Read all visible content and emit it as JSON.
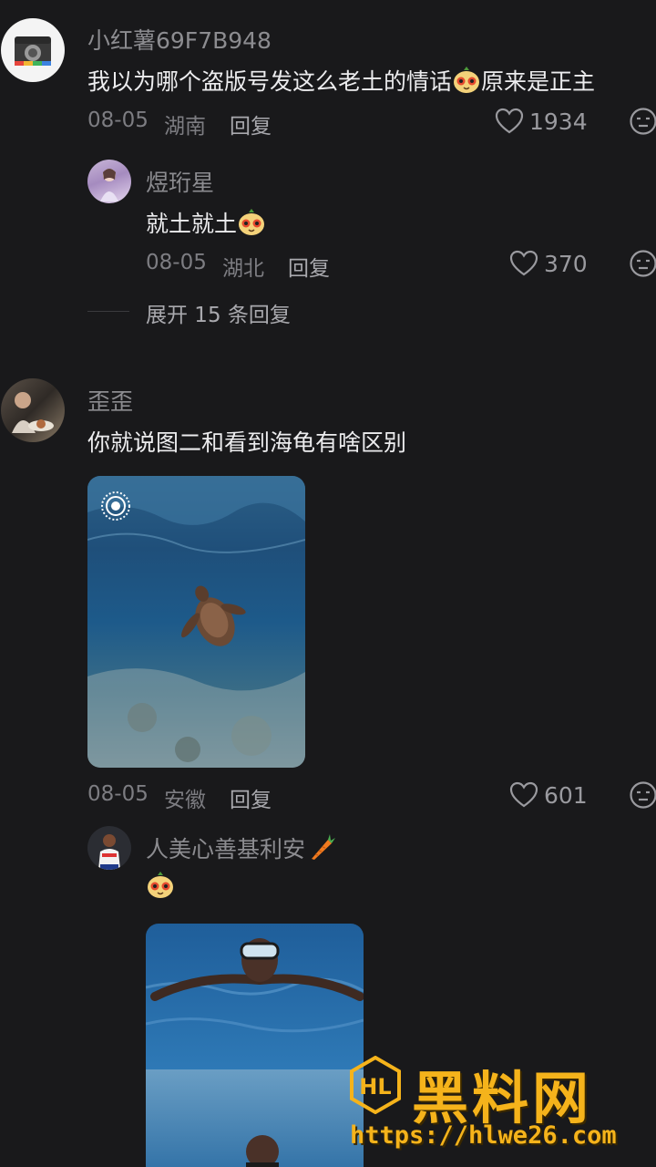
{
  "comments": [
    {
      "username": "小红薯69F7B948",
      "text_before": "我以为哪个盗版号发这么老土的情话",
      "text_after": "原来是正主",
      "date": "08-05",
      "location": "湖南",
      "reply_label": "回复",
      "likes": "1934",
      "replies": [
        {
          "username": "煜珩星",
          "text": "就土就土",
          "date": "08-05",
          "location": "湖北",
          "reply_label": "回复",
          "likes": "370"
        }
      ],
      "expand_label": "展开 15 条回复"
    },
    {
      "username": "歪歪",
      "text": "你就说图二和看到海龟有啥区别",
      "date": "08-05",
      "location": "安徽",
      "reply_label": "回复",
      "likes": "601",
      "replies": [
        {
          "username": "人美心善基利安"
        }
      ]
    }
  ],
  "watermark": {
    "brand": "黑料网",
    "url": "https://hlwe26.com"
  },
  "colors": {
    "background": "#19191b",
    "watermark": "#f5b31b"
  }
}
